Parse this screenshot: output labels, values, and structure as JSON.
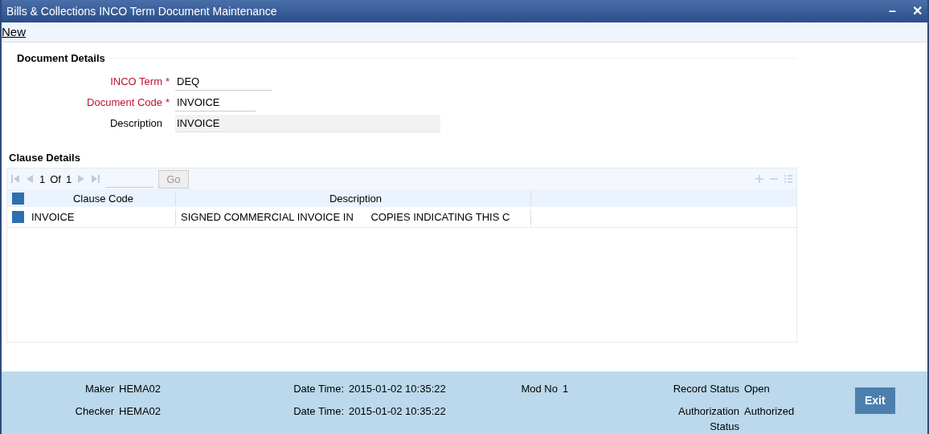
{
  "window": {
    "title": "Bills & Collections INCO Term Document Maintenance",
    "controls": [
      "–",
      "✕"
    ]
  },
  "menu": [
    "New"
  ],
  "document_details": {
    "title": "Document Details",
    "fields": [
      {
        "label": "INCO Term",
        "required": true,
        "required_mark": "*",
        "value": "DEQ",
        "readonly": false
      },
      {
        "label": "Document Code",
        "required": true,
        "required_mark": "*",
        "value": "INVOICE",
        "readonly": false
      },
      {
        "label": "Description",
        "required": false,
        "value": "INVOICE",
        "readonly": true
      }
    ]
  },
  "clause_details": {
    "title": "Clause Details",
    "pager": {
      "page": "1",
      "of_label": "Of",
      "total": "1",
      "go": "Go"
    },
    "all_selected": false,
    "columns": [
      "Clause Code",
      "Description"
    ],
    "rows": [
      {
        "selected": false,
        "cells": [
          "INVOICE",
          "SIGNED COMMERCIAL INVOICE IN      COPIES INDICATING THIS C"
        ]
      }
    ]
  },
  "footer": {
    "columns": [
      [
        {
          "label": "Maker",
          "value": "HEMA02"
        },
        {
          "label": "Checker",
          "value": "HEMA02"
        }
      ],
      [
        {
          "label": "Date Time:",
          "value": "2015-01-02 10:35:22"
        },
        {
          "label": "Date Time:",
          "value": "2015-01-02 10:35:22"
        }
      ],
      [
        {
          "label": "Mod No",
          "value": "1"
        }
      ],
      [
        {
          "label": "Record Status",
          "value": "Open"
        },
        {
          "label": "Authorization Status",
          "value": "Authorized"
        }
      ]
    ],
    "exit": "Exit"
  }
}
